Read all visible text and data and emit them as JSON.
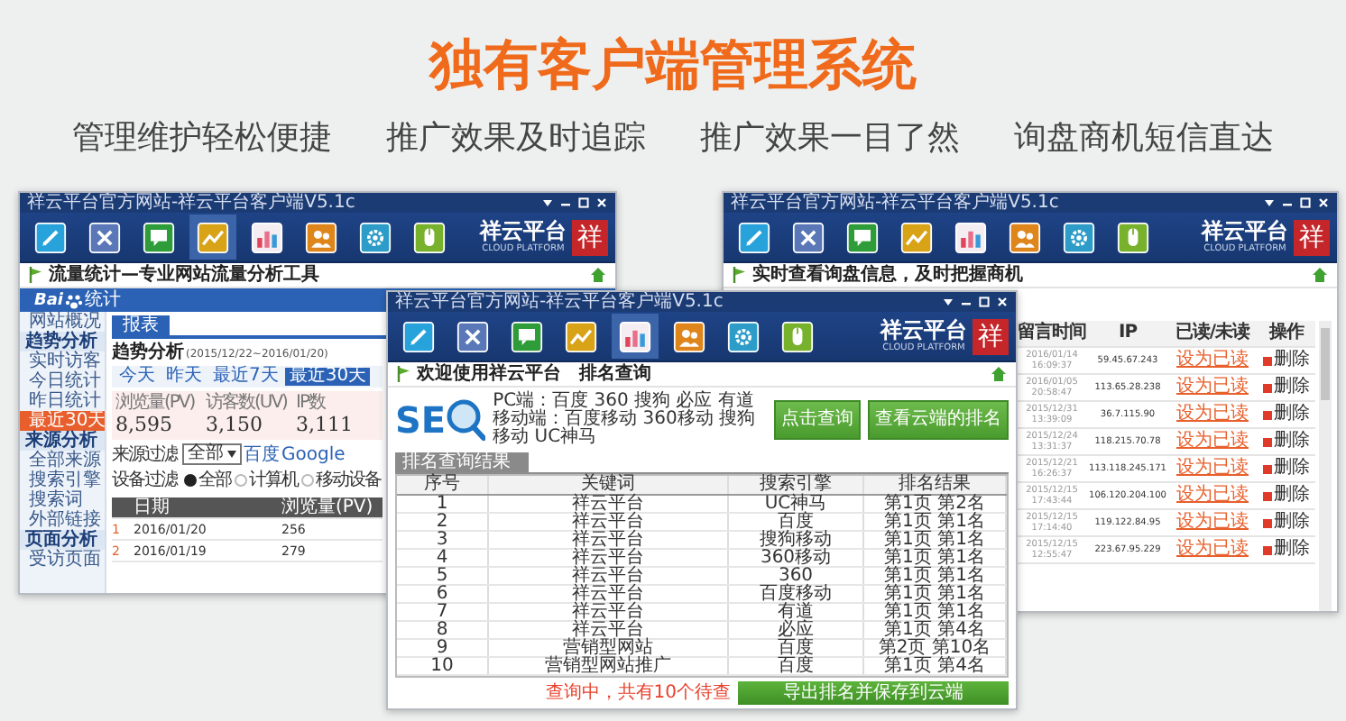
{
  "header": {
    "title": "独有客户端管理系统",
    "features": [
      "管理维护轻松便捷",
      "推广效果及时追踪",
      "推广效果一目了然",
      "询盘商机短信直达"
    ]
  },
  "windows": [
    {
      "kind": "traffic",
      "title_bar": "祥云平台官方网站-祥云平台客户端V5.1c",
      "toolbar": [
        {
          "selected": false
        },
        {
          "selected": false
        },
        {
          "selected": false
        },
        {
          "selected": true
        },
        {
          "selected": false
        },
        {
          "selected": false
        },
        {
          "selected": false
        },
        {
          "selected": false
        }
      ],
      "logo": {
        "name": "祥云平台",
        "tagline": "CLOUD PLATFORM",
        "seal": "祥"
      },
      "heading": "流量统计—专业网站流量分析工具",
      "brand": {
        "text_before": "Bai",
        "text_after": "统计"
      },
      "sidebar": [
        {
          "label": "网站概况",
          "kind": "item",
          "selected": false
        },
        {
          "label": "趋势分析",
          "kind": "group",
          "selected": false
        },
        {
          "label": "实时访客",
          "kind": "item",
          "selected": false
        },
        {
          "label": "今日统计",
          "kind": "item",
          "selected": false
        },
        {
          "label": "昨日统计",
          "kind": "item",
          "selected": false
        },
        {
          "label": "最近30天",
          "kind": "item",
          "selected": true
        },
        {
          "label": "来源分析",
          "kind": "group",
          "selected": false
        },
        {
          "label": "全部来源",
          "kind": "item",
          "selected": false
        },
        {
          "label": "搜索引擎",
          "kind": "item",
          "selected": false
        },
        {
          "label": "搜索词",
          "kind": "item",
          "selected": false
        },
        {
          "label": "外部链接",
          "kind": "item",
          "selected": false
        },
        {
          "label": "页面分析",
          "kind": "group",
          "selected": false
        },
        {
          "label": "受访页面",
          "kind": "item",
          "selected": false
        }
      ],
      "tab": "报表",
      "report_title": "趋势分析",
      "report_range": "(2015/12/22~2016/01/20)",
      "periods": [
        {
          "label": "今天",
          "selected": false
        },
        {
          "label": "昨天",
          "selected": false
        },
        {
          "label": "最近7天",
          "selected": false
        },
        {
          "label": "最近30天",
          "selected": true
        }
      ],
      "stats": [
        {
          "label": "浏览量(PV)",
          "value": "8,595"
        },
        {
          "label": "访客数(UV)",
          "value": "3,150"
        },
        {
          "label": "IP数",
          "value": "3,111"
        }
      ],
      "source_filter": {
        "label": "来源过滤",
        "value": "全部",
        "links": [
          "百度",
          "Google"
        ]
      },
      "device_filter": {
        "label": "设备过滤",
        "options": [
          {
            "label": "全部",
            "selected": true
          },
          {
            "label": "计算机",
            "selected": false
          },
          {
            "label": "移动设备",
            "selected": false
          }
        ]
      },
      "table": {
        "columns": [
          "",
          "日期",
          "浏览量(PV)"
        ],
        "rows": [
          [
            "1",
            "2016/01/20",
            "256"
          ],
          [
            "2",
            "2016/01/19",
            "279"
          ]
        ]
      }
    },
    {
      "kind": "ranking",
      "title_bar": "祥云平台官方网站-祥云平台客户端V5.1c",
      "toolbar": [
        {
          "selected": false
        },
        {
          "selected": false
        },
        {
          "selected": false
        },
        {
          "selected": false
        },
        {
          "selected": true
        },
        {
          "selected": false
        },
        {
          "selected": false
        },
        {
          "selected": false
        }
      ],
      "logo": {
        "name": "祥云平台",
        "tagline": "CLOUD PLATFORM",
        "seal": "祥"
      },
      "heading": "欢迎使用祥云平台　排名查询",
      "seo_logo": "SE",
      "engines": [
        "PC端：百度 360 搜狗 必应 有道",
        "移动端：百度移动 360移动 搜狗移动 UC神马"
      ],
      "buttons": [
        "点击查询",
        "查看云端的排名"
      ],
      "results_tab": "排名查询结果",
      "table": {
        "columns": [
          "序号",
          "关键词",
          "搜索引擎",
          "排名结果"
        ],
        "rows": [
          [
            "1",
            "祥云平台",
            "UC神马",
            "第1页 第2名"
          ],
          [
            "2",
            "祥云平台",
            "百度",
            "第1页 第1名"
          ],
          [
            "3",
            "祥云平台",
            "搜狗移动",
            "第1页 第1名"
          ],
          [
            "4",
            "祥云平台",
            "360移动",
            "第1页 第1名"
          ],
          [
            "5",
            "祥云平台",
            "360",
            "第1页 第1名"
          ],
          [
            "6",
            "祥云平台",
            "百度移动",
            "第1页 第1名"
          ],
          [
            "7",
            "祥云平台",
            "有道",
            "第1页 第1名"
          ],
          [
            "8",
            "祥云平台",
            "必应",
            "第1页 第4名"
          ],
          [
            "9",
            "营销型网站",
            "百度",
            "第2页 第10名"
          ],
          [
            "10",
            "营销型网站推广",
            "百度",
            "第1页 第4名"
          ]
        ]
      },
      "status": "查询中，共有10个待查",
      "export_button": "导出排名并保存到云端"
    },
    {
      "kind": "inquiry",
      "title_bar": "祥云平台官方网站-祥云平台客户端V5.1c",
      "toolbar": [
        {
          "selected": false
        },
        {
          "selected": false
        },
        {
          "selected": false
        },
        {
          "selected": false
        },
        {
          "selected": false
        },
        {
          "selected": false
        },
        {
          "selected": false
        },
        {
          "selected": false
        }
      ],
      "logo": {
        "name": "祥云平台",
        "tagline": "CLOUD PLATFORM",
        "seal": "祥"
      },
      "heading": "实时查看询盘信息，及时把握商机",
      "table": {
        "columns": [
          "留言时间",
          "IP",
          "已读/未读",
          "操作"
        ],
        "rows": [
          {
            "time": "2016/01/14 16:09:37",
            "ip": "59.45.67.243",
            "read": "设为已读",
            "action": "删除"
          },
          {
            "time": "2016/01/05 20:58:47",
            "ip": "113.65.28.238",
            "read": "设为已读",
            "action": "删除"
          },
          {
            "time": "2015/12/31 13:39:09",
            "ip": "36.7.115.90",
            "read": "设为已读",
            "action": "删除"
          },
          {
            "time": "2015/12/24 13:31:37",
            "ip": "118.215.70.78",
            "read": "设为已读",
            "action": "删除"
          },
          {
            "time": "2015/12/21 16:26:37",
            "ip": "113.118.245.171",
            "read": "设为已读",
            "action": "删除"
          },
          {
            "time": "2015/12/15 17:43:44",
            "ip": "106.120.204.100",
            "read": "设为已读",
            "action": "删除"
          },
          {
            "time": "2015/12/15 17:14:40",
            "ip": "119.122.84.95",
            "read": "设为已读",
            "action": "删除"
          },
          {
            "time": "2015/12/15 12:55:47",
            "ip": "223.67.95.229",
            "read": "设为已读",
            "action": "删除"
          }
        ]
      }
    }
  ]
}
